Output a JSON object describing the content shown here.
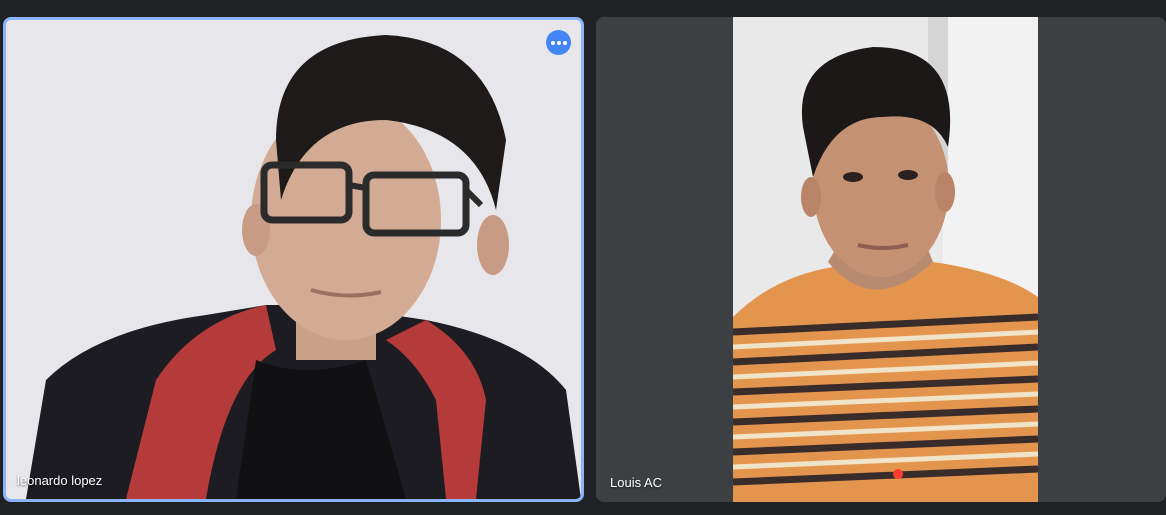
{
  "meeting": {
    "participants": [
      {
        "name": "leonardo lopez",
        "pinned": true,
        "accent": "#8ab4f8"
      },
      {
        "name": "Louis AC",
        "pinned": false
      }
    ],
    "more_options_icon": "more-horizontal-icon",
    "colors": {
      "background": "#202124",
      "tile_background": "#3c4043",
      "active_border": "#8ab4f8",
      "button_blue": "#4285f4"
    }
  }
}
